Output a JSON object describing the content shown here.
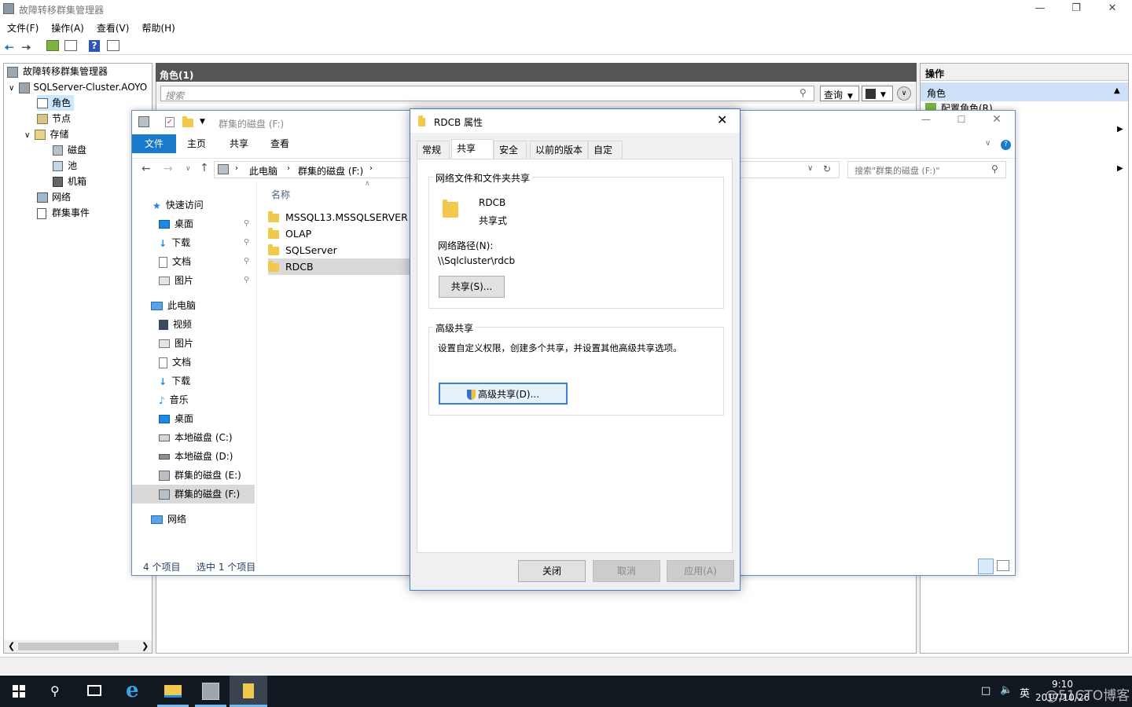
{
  "mmc": {
    "title": "故障转移群集管理器",
    "menu": [
      "文件(F)",
      "操作(A)",
      "查看(V)",
      "帮助(H)"
    ],
    "tree": {
      "root": "故障转移群集管理器",
      "cluster": "SQLServer-Cluster.AOYO",
      "items": [
        "角色",
        "节点",
        "存储",
        "磁盘",
        "池",
        "机箱",
        "网络",
        "群集事件"
      ]
    },
    "center": {
      "header": "角色(1)",
      "search_placeholder": "搜索",
      "query_btn": "查询"
    },
    "ops": {
      "header": "操作",
      "section": "角色",
      "first_item": "配置角色(R)..."
    }
  },
  "explorer": {
    "title": "群集的磁盘 (F:)",
    "ribbon_tabs": [
      "文件",
      "主页",
      "共享",
      "查看"
    ],
    "breadcrumb": [
      "此电脑",
      "群集的磁盘 (F:)"
    ],
    "search_placeholder": "搜索\"群集的磁盘 (F:)\"",
    "nav": {
      "quick_access": "快速访问",
      "quick_items": [
        "桌面",
        "下载",
        "文档",
        "图片"
      ],
      "this_pc": "此电脑",
      "pc_items": [
        "视频",
        "图片",
        "文档",
        "下载",
        "音乐",
        "桌面",
        "本地磁盘 (C:)",
        "本地磁盘 (D:)",
        "群集的磁盘 (E:)",
        "群集的磁盘 (F:)"
      ],
      "network": "网络"
    },
    "column_name": "名称",
    "files": [
      "MSSQL13.MSSQLSERVER",
      "OLAP",
      "SQLServer",
      "RDCB"
    ],
    "status_count": "4 个项目",
    "status_selected": "选中 1 个项目"
  },
  "dialog": {
    "title": "RDCB 属性",
    "tabs": [
      "常规",
      "共享",
      "安全",
      "以前的版本",
      "自定义"
    ],
    "share_group_title": "网络文件和文件夹共享",
    "folder_name": "RDCB",
    "folder_state": "共享式",
    "path_label": "网络路径(N):",
    "path_value": "\\\\Sqlcluster\\rdcb",
    "share_btn": "共享(S)...",
    "adv_group_title": "高级共享",
    "adv_desc": "设置自定义权限，创建多个共享，并设置其他高级共享选项。",
    "adv_btn": "高级共享(D)...",
    "close_btn": "关闭",
    "cancel_btn": "取消",
    "apply_btn": "应用(A)"
  },
  "taskbar": {
    "ime": "英",
    "time": "9:10",
    "date": "2017/10/26",
    "watermark": "@51CTO博客"
  }
}
